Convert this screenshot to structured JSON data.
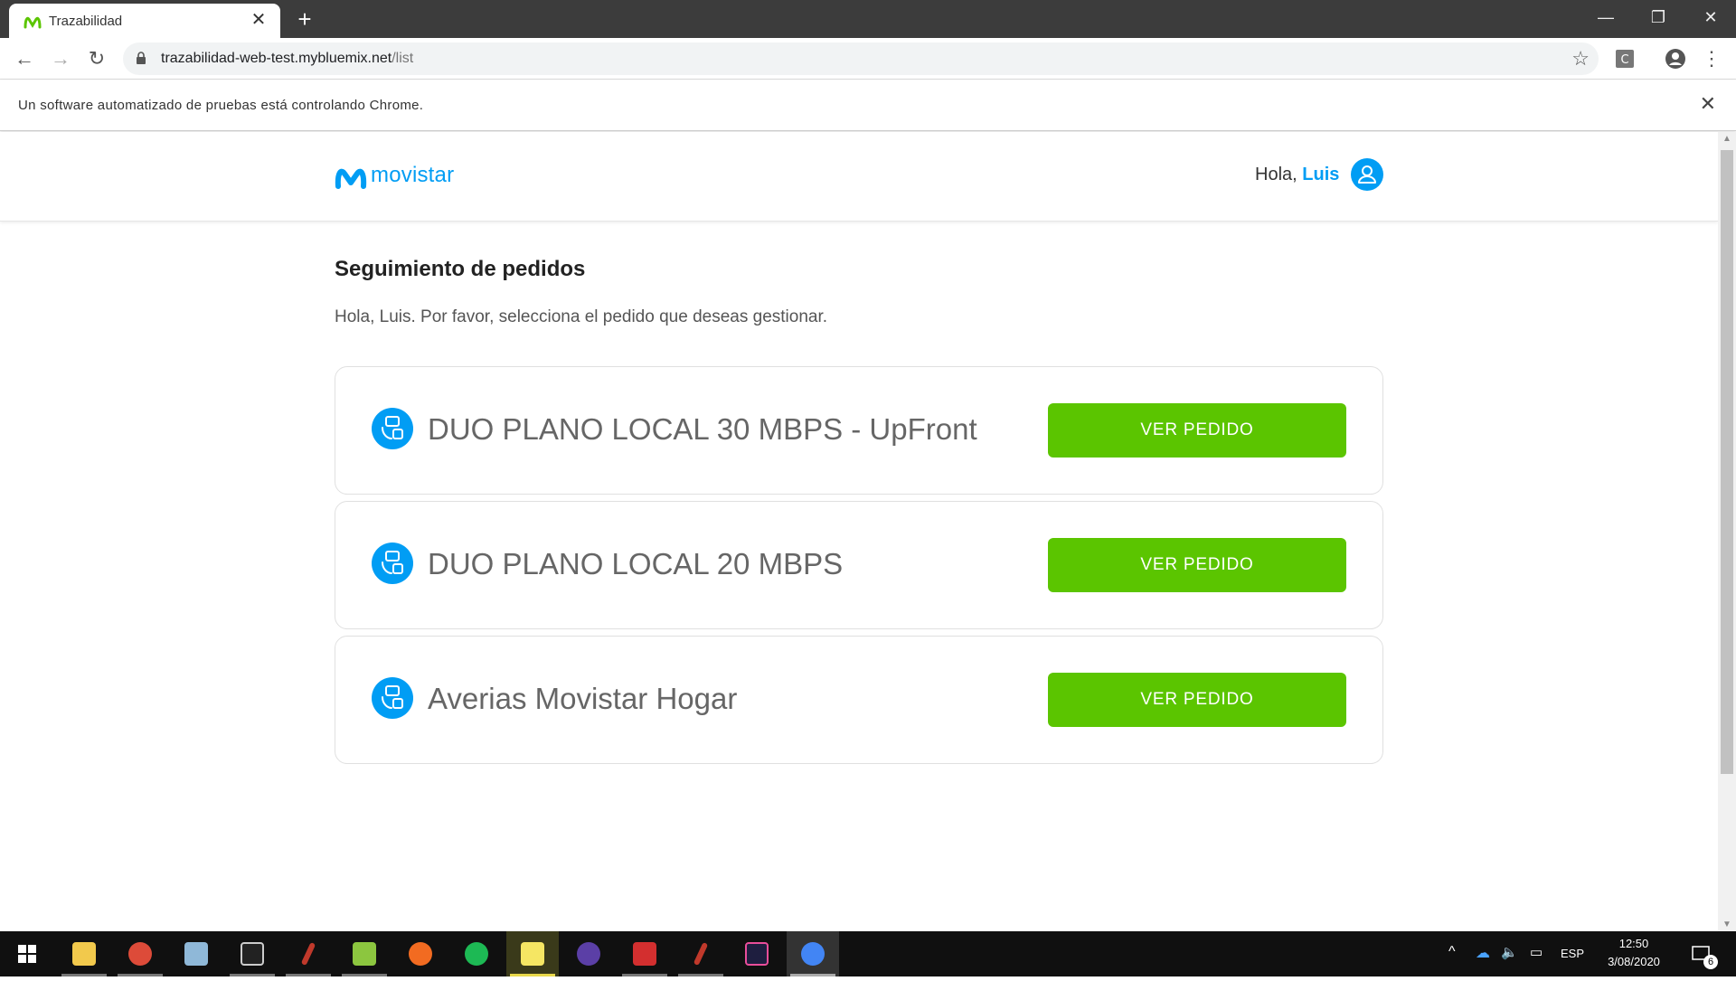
{
  "browser": {
    "tab_title": "Trazabilidad",
    "url_host": "trazabilidad-web-test.mybluemix.net",
    "url_path": "/list",
    "infobar_message": "Un software automatizado de pruebas está controlando Chrome."
  },
  "header": {
    "logo_text": "movistar",
    "greeting": "Hola,",
    "user_name": "Luis"
  },
  "main": {
    "title": "Seguimiento de pedidos",
    "subtitle": "Hola, Luis. Por favor, selecciona el pedido que deseas gestionar.",
    "orders": [
      {
        "name": "DUO PLANO LOCAL 30 MBPS - UpFront",
        "button": "VER PEDIDO"
      },
      {
        "name": "DUO PLANO LOCAL 20 MBPS",
        "button": "VER PEDIDO"
      },
      {
        "name": "Averias Movistar Hogar",
        "button": "VER PEDIDO"
      }
    ]
  },
  "taskbar": {
    "language": "ESP",
    "time": "12:50",
    "date": "3/08/2020",
    "notifications": "6"
  },
  "colors": {
    "brand": "#019df4",
    "button": "#5bc500"
  }
}
